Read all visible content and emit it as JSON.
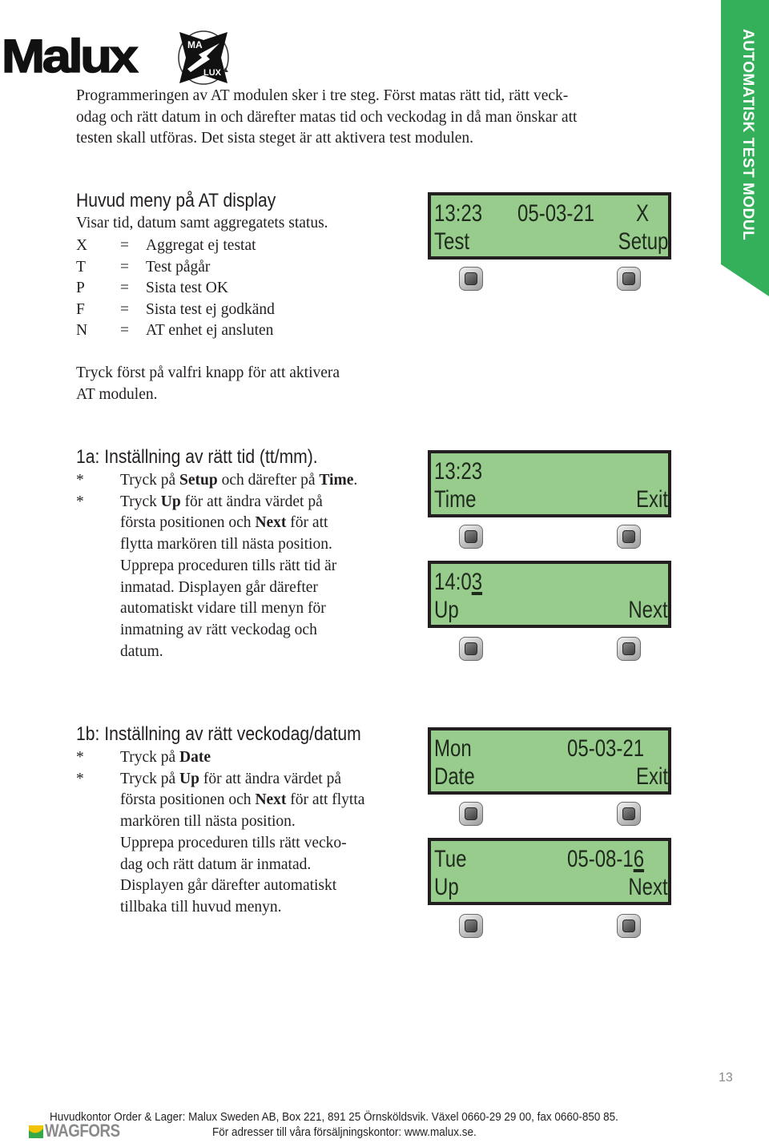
{
  "brand": {
    "logo_text": "Malux",
    "badge_top": "MA",
    "badge_bottom": "LUX",
    "accent_green": "#35b05a",
    "lcd_green": "#97cc8d"
  },
  "side_tab": {
    "label": "AUTOMATISK TEST MODUL"
  },
  "intro": {
    "lines": [
      "Programmeringen av AT modulen sker i tre steg. Först matas rätt tid, rätt veck-",
      "odag och rätt datum in och därefter matas tid och veckodag in då man önskar att",
      "testen skall utföras. Det sista steget är att aktivera test modulen."
    ]
  },
  "main_menu": {
    "heading": "Huvud meny på AT display",
    "subtitle": "Visar tid, datum samt aggregatets status.",
    "legend": [
      {
        "key": "X",
        "eq": "=",
        "value": "Aggregat ej testat"
      },
      {
        "key": "T",
        "eq": "=",
        "value": "Test pågår"
      },
      {
        "key": "P",
        "eq": "=",
        "value": "Sista test OK"
      },
      {
        "key": "F",
        "eq": "=",
        "value": "Sista test ej godkänd"
      },
      {
        "key": "N",
        "eq": "=",
        "value": "AT enhet ej ansluten"
      }
    ],
    "activate_lines": [
      "Tryck först på valfri knapp för att aktivera",
      "AT modulen."
    ],
    "display": {
      "time": "13:23",
      "date": "05-03-21",
      "status": "X",
      "left_soft": "Test",
      "right_soft": "Setup"
    }
  },
  "step_1a": {
    "heading": "1a: Inställning av rätt tid (tt/mm).",
    "bullet": "*",
    "item1": {
      "pre": "Tryck på ",
      "b1": "Setup",
      "mid": " och därefter på ",
      "b2": "Time",
      "post": "."
    },
    "item2": {
      "l1_pre": "Tryck ",
      "l1_b": "Up",
      "l1_post": " för att ändra värdet på",
      "l2_pre": "första positionen och ",
      "l2_b": "Next",
      "l2_post": " för att",
      "rest": [
        "flytta markören till nästa position.",
        "Upprepa proceduren tills rätt tid är",
        "inmatad. Displayen går därefter",
        "automatiskt vidare till menyn för",
        "inmatning av rätt veckodag och",
        "datum."
      ]
    },
    "display1": {
      "time": "13:23",
      "left_soft": "Time",
      "right_soft": "Exit"
    },
    "display2": {
      "time_prefix": "14:0",
      "time_cursor": "3",
      "left_soft": "Up",
      "right_soft": "Next"
    }
  },
  "step_1b": {
    "heading": "1b: Inställning av rätt veckodag/datum",
    "bullet": "*",
    "item1": {
      "pre": "Tryck på ",
      "b1": "Date"
    },
    "item2": {
      "l1_pre": "Tryck på ",
      "l1_b": "Up",
      "l1_post": " för att ändra värdet på",
      "l2_pre": "första positionen och ",
      "l2_b": "Next",
      "l2_post": " för att flytta",
      "rest": [
        "markören till nästa position.",
        "Upprepa proceduren tills rätt vecko-",
        "dag och rätt datum är inmatad.",
        "Displayen går därefter automatiskt",
        "tillbaka till huvud menyn."
      ]
    },
    "display1": {
      "day": "Mon",
      "date": "05-03-21",
      "left_soft": "Date",
      "right_soft": "Exit"
    },
    "display2": {
      "day": "Tue",
      "date_prefix": "05-08-1",
      "date_cursor": "6",
      "left_soft": "Up",
      "right_soft": "Next"
    }
  },
  "page_number": "13",
  "footer": {
    "line1": "Huvudkontor Order & Lager: Malux Sweden AB, Box 221, 891 25 Örnsköldsvik. Växel 0660-29 29 00, fax 0660-850 85.",
    "line2": "För adresser till våra försäljningskontor:  www.malux.se.",
    "partner_logo": "WAGFORS"
  }
}
